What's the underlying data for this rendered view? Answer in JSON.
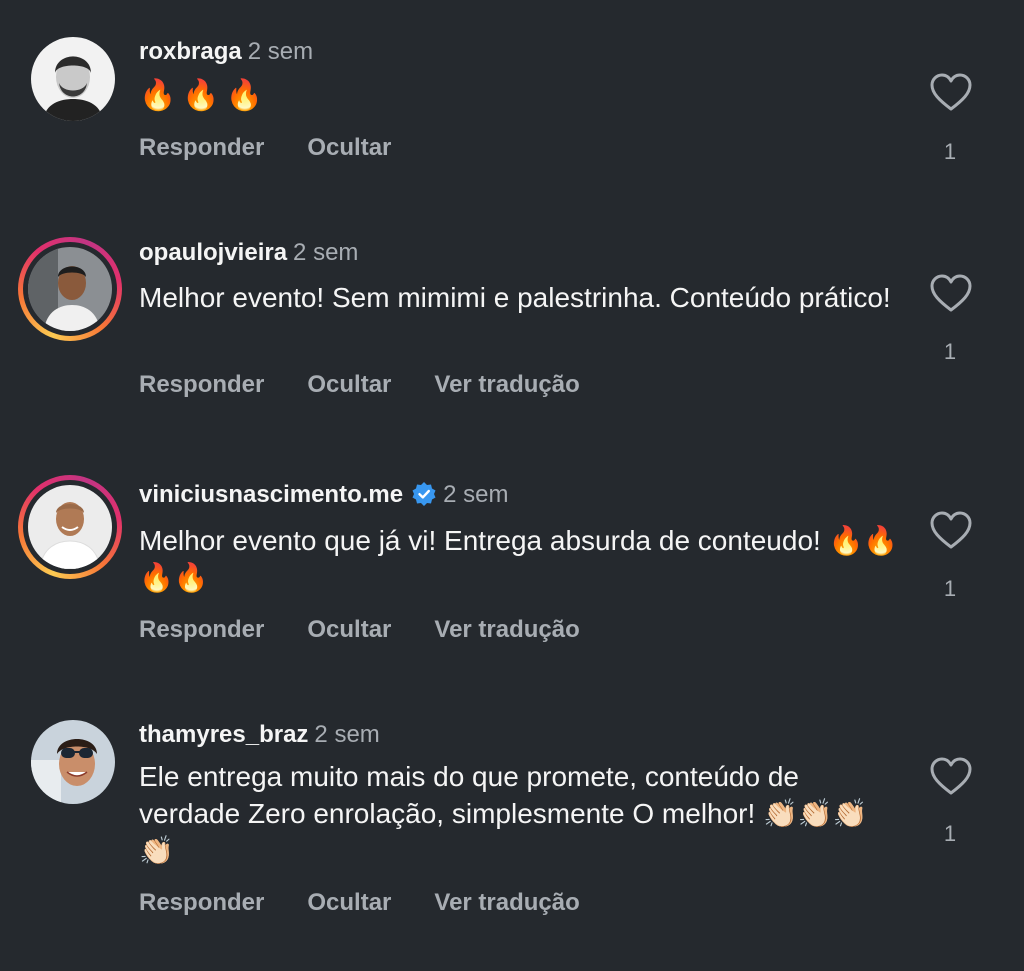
{
  "comments": [
    {
      "username": "roxbraga",
      "time": "2 sem",
      "text": "🔥🔥🔥",
      "actions": [
        "Responder",
        "Ocultar"
      ],
      "likes": "1",
      "story_ring": false,
      "verified": false
    },
    {
      "username": "opaulojvieira",
      "time": "2 sem",
      "text": "Melhor evento! Sem mimimi e palestrinha. Conteúdo prático!",
      "actions": [
        "Responder",
        "Ocultar",
        "Ver tradução"
      ],
      "likes": "1",
      "story_ring": true,
      "verified": false
    },
    {
      "username": "viniciusnascimento.me",
      "time": "2 sem",
      "text": "Melhor evento que já vi! Entrega absurda de conteudo! 🔥🔥🔥🔥",
      "actions": [
        "Responder",
        "Ocultar",
        "Ver tradução"
      ],
      "likes": "1",
      "story_ring": true,
      "verified": true
    },
    {
      "username": "thamyres_braz",
      "time": "2 sem",
      "text": "Ele entrega muito mais do que promete, conteúdo de verdade Zero enrolação, simplesmente O melhor! 👏🏻👏🏻👏🏻👏🏻",
      "actions": [
        "Responder",
        "Ocultar",
        "Ver tradução"
      ],
      "likes": "1",
      "story_ring": false,
      "verified": false
    }
  ],
  "colors": {
    "background": "#25292e",
    "text": "#f5f5f5",
    "secondary": "#a8adb3",
    "verified_blue": "#3897f0",
    "fire": "#ff6a00"
  },
  "icons": {
    "like": "heart-outline-icon",
    "verified": "verified-badge-icon"
  }
}
